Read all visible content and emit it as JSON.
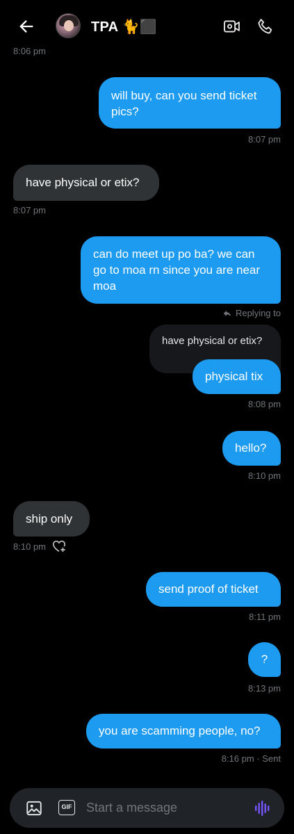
{
  "header": {
    "title": "TPA 🐈⬛",
    "back_icon": "arrow-left-icon",
    "video_icon": "video-camera-icon",
    "call_icon": "phone-icon"
  },
  "messages": [
    {
      "type": "timestamp",
      "text": "8:06 pm"
    },
    {
      "direction": "out",
      "text": "will buy, can you send ticket pics?",
      "time": "8:07 pm"
    },
    {
      "direction": "in",
      "text": "have physical or etix?",
      "time": "8:07 pm"
    },
    {
      "direction": "out",
      "text": "can do meet up po ba? we can go to moa rn since you are near moa"
    },
    {
      "direction": "out",
      "reply_label": "Replying to",
      "quoted": "have physical or etix?",
      "text": "physical tix",
      "time": "8:08 pm"
    },
    {
      "direction": "out",
      "text": "hello?",
      "time": "8:10 pm"
    },
    {
      "direction": "in",
      "text": "ship only",
      "time": "8:10 pm"
    },
    {
      "direction": "out",
      "text": "send proof of ticket",
      "time": "8:11 pm"
    },
    {
      "direction": "out",
      "text": "?",
      "time": "8:13 pm"
    },
    {
      "direction": "out",
      "text": "you are scamming people, no?",
      "time": "8:16 pm · Sent"
    }
  ],
  "composer": {
    "placeholder": "Start a message",
    "gif_label": "GIF",
    "image_icon": "image-icon",
    "voice_icon": "voice-wave-icon"
  },
  "colors": {
    "accent": "#1d9bf0",
    "incoming": "#2f3336",
    "background": "#000000",
    "muted": "#71767b",
    "voice": "#7856ff"
  }
}
